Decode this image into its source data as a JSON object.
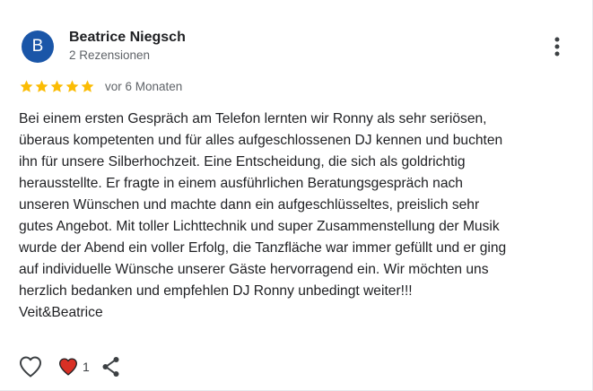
{
  "review": {
    "avatar_letter": "B",
    "avatar_color": "#1a56a8",
    "reviewer_name": "Beatrice Niegsch",
    "review_count": "2 Rezensionen",
    "rating": 5,
    "rating_max": 5,
    "star_color": "#fbbc04",
    "date": "vor 6 Monaten",
    "text": "Bei einem ersten Gespräch am Telefon lernten wir Ronny als sehr seriösen,\nüberaus kompetenten und für alles aufgeschlossenen DJ kennen und buchten\nihn für unsere Silberhochzeit. Eine Entscheidung, die sich als goldrichtig\nherausstellte. Er fragte in einem ausführlichen Beratungsgespräch nach\nunseren Wünschen und machte dann ein aufgeschlüsseltes, preislich sehr\ngutes Angebot. Mit toller Lichttechnik und super Zusammenstellung der Musik\nwurde der Abend ein voller Erfolg, die Tanzfläche war immer gefüllt und er ging\nauf individuelle Wünsche unserer Gäste hervorragend ein. Wir möchten uns\nherzlich bedanken und empfehlen DJ Ronny unbedingt weiter!!!\nVeit&Beatrice"
  },
  "actions": {
    "like_icon": "heart-outline-icon",
    "love_icon": "heart-filled-icon",
    "love_color": "#d93025",
    "love_count": "1",
    "share_icon": "share-icon",
    "more_icon": "more-vert-icon"
  }
}
